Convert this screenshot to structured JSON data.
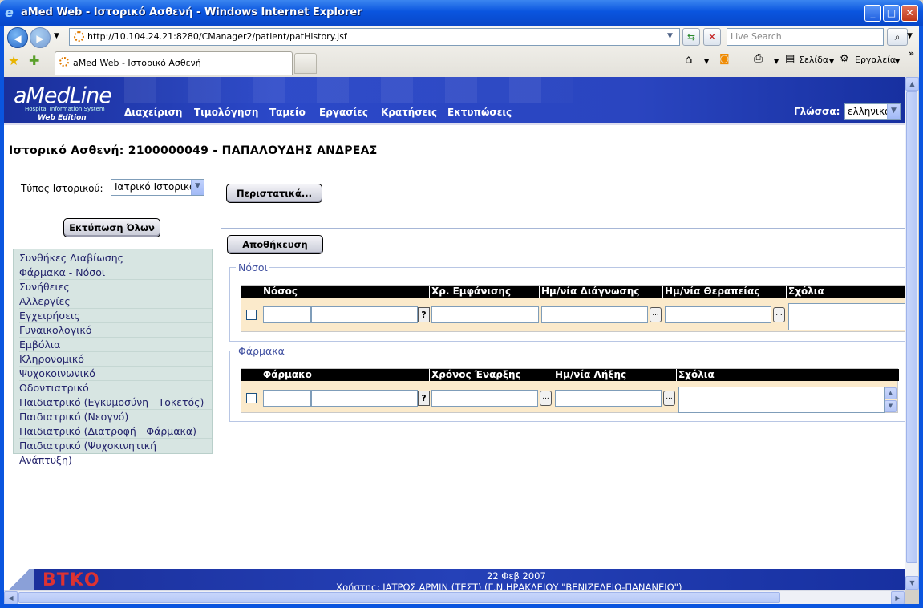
{
  "window": {
    "title": "aMed Web - Ιστορικό Ασθενή - Windows Internet Explorer"
  },
  "browser": {
    "address": "http://10.104.24.21:8280/CManager2/patient/patHistory.jsf",
    "search_placeholder": "Live Search",
    "tab_title": "aMed Web - Ιστορικό Ασθενή",
    "cmd_page": "Σελίδα",
    "cmd_tools": "Εργαλεία"
  },
  "app": {
    "logo": "aMedLine",
    "logo_sub": "Hospital Information System",
    "logo_edition": "Web Edition",
    "menu": [
      "Διαχείριση",
      "Τιμολόγηση",
      "Ταμείο",
      "Εργασίες",
      "Κρατήσεις",
      "Εκτυπώσεις"
    ],
    "language_label": "Γλώσσα:",
    "language_value": "ελληνικά"
  },
  "page": {
    "heading": "Ιστορικό Ασθενή: 2100000049 - ΠΑΠΑΛΟΥΔΗΣ ΑΝΔΡΕΑΣ",
    "history_type_label": "Τύπος Ιστορικού:",
    "history_type_value": "Ιατρικό Ιστορικό",
    "incidents_button": "Περιστατικά...",
    "print_all_button": "Εκτύπωση Όλων",
    "save_button": "Αποθήκευση",
    "sidebar": [
      "Συνθήκες Διαβίωσης",
      "Φάρμακα - Νόσοι",
      "Συνήθειες",
      "Αλλεργίες",
      "Εγχειρήσεις",
      "Γυναικολογικό",
      "Εμβόλια",
      "Κληρονομικό",
      "Ψυχοκοινωνικό",
      "Οδοντιατρικό",
      "Παιδιατρικό (Εγκυμοσύνη - Τοκετός)",
      "Παιδιατρικό (Νεογνό)",
      "Παιδιατρικό (Διατροφή - Φάρμακα)",
      "Παιδιατρικό (Ψυχοκινητική Ανάπτυξη)"
    ],
    "diseases": {
      "legend": "Νόσοι",
      "columns": [
        "Νόσος",
        "Χρ. Εμφάνισης",
        "Ημ/νία Διάγνωσης",
        "Ημ/νία Θεραπείας",
        "Σχόλια"
      ]
    },
    "drugs": {
      "legend": "Φάρμακα",
      "columns": [
        "Φάρμακο",
        "Χρόνος Έναρξης",
        "Ημ/νία Λήξης",
        "Σχόλια"
      ]
    },
    "footer_date": "22 Φεβ 2007",
    "footer_user": "Χρήστης: ΙΑΤΡΟΣ ΑΡΜΙΝ (ΤΕΣΤ) (Γ.Ν.ΗΡΑΚΛΕΙΟΥ \"ΒΕΝΙΖΕΛΕΙΟ-ΠΑΝΑΝΕΙΟ\")"
  }
}
